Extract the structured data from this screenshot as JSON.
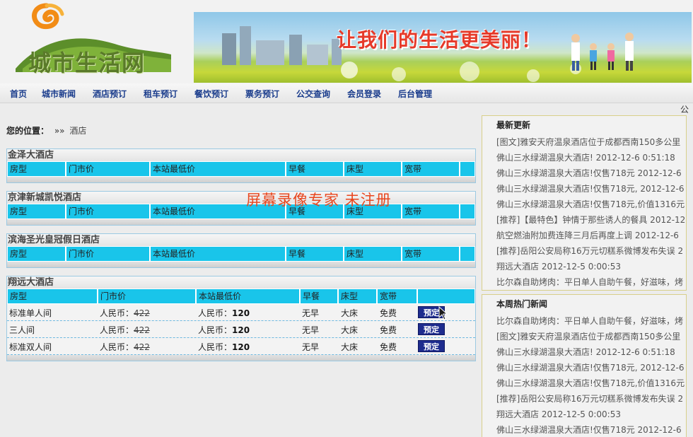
{
  "logo": {
    "text": "城市生活网",
    "icon": "swirl-logo-icon"
  },
  "banner": {
    "slogan": "让我们的生活更美丽！"
  },
  "nav": [
    "首页",
    "城市新闻",
    "酒店预订",
    "租车预订",
    "餐饮预订",
    "票务预订",
    "公交查询",
    "会员登录",
    "后台管理"
  ],
  "marquee": "公",
  "breadcrumb": {
    "label": "您的位置：",
    "sep": "»»",
    "current": "酒店"
  },
  "columns": [
    "房型",
    "门市价",
    "本站最低价",
    "早餐",
    "床型",
    "宽带"
  ],
  "hotels": [
    {
      "name": "金泽大酒店",
      "rooms": []
    },
    {
      "name": "京津新城凯悦酒店",
      "rooms": []
    },
    {
      "name": "滨海圣光皇冠假日酒店",
      "rooms": []
    },
    {
      "name": "翔远大酒店",
      "rooms": [
        {
          "type": "标准单人间",
          "market_prefix": "人民币：",
          "market_price": "422",
          "site_prefix": "人民币：",
          "site_price": "120",
          "breakfast": "无早",
          "bed": "大床",
          "broadband": "免费",
          "button": "预定"
        },
        {
          "type": "三人间",
          "market_prefix": "人民币：",
          "market_price": "422",
          "site_prefix": "人民币：",
          "site_price": "120",
          "breakfast": "无早",
          "bed": "大床",
          "broadband": "免费",
          "button": "预定"
        },
        {
          "type": "标准双人间",
          "market_prefix": "人民币：",
          "market_price": "422",
          "site_prefix": "人民币：",
          "site_price": "120",
          "breakfast": "无早",
          "bed": "大床",
          "broadband": "免费",
          "button": "预定"
        }
      ]
    }
  ],
  "watermark": "屏幕录像专家  未注册",
  "latest": {
    "title": "最新更新",
    "items": [
      "[图文]雅安天府温泉酒店位于成都西南150多公里",
      "佛山三水绿湖温泉大酒店! 2012-12-6 0:51:18",
      "佛山三水绿湖温泉大酒店!仅售718元 2012-12-6",
      "佛山三水绿湖温泉大酒店!仅售718元, 2012-12-6",
      "佛山三水绿湖温泉大酒店!仅售718元,价值1316元",
      "[推荐]【最特色】钟情于那些诱人的餐具 2012-12-",
      "航空燃油附加费连降三月后再度上调 2012-12-6",
      "[推荐]岳阳公安局称16万元切糕系微博发布失误 2",
      "翔远大酒店 2012-12-5 0:00:53",
      "比尔森自助烤肉：平日单人自助午餐，好滋味，烤"
    ]
  },
  "hot": {
    "title": "本周热门新闻",
    "items": [
      "比尔森自助烤肉：平日单人自助午餐，好滋味，烤",
      "[图文]雅安天府温泉酒店位于成都西南150多公里",
      "佛山三水绿湖温泉大酒店! 2012-12-6 0:51:18",
      "佛山三水绿湖温泉大酒店!仅售718元, 2012-12-6",
      "佛山三水绿湖温泉大酒店!仅售718元,价值1316元",
      "[推荐]岳阳公安局称16万元切糕系微博发布失误 2",
      "翔远大酒店 2012-12-5 0:00:53",
      "佛山三水绿湖温泉大酒店!仅售718元 2012-12-6"
    ]
  },
  "colors": {
    "nav_text": "#1a3c8c",
    "table_header": "#19c5ea",
    "book_button": "#1e2c8e",
    "slogan": "#e63a2a",
    "watermark": "#e8461e"
  }
}
